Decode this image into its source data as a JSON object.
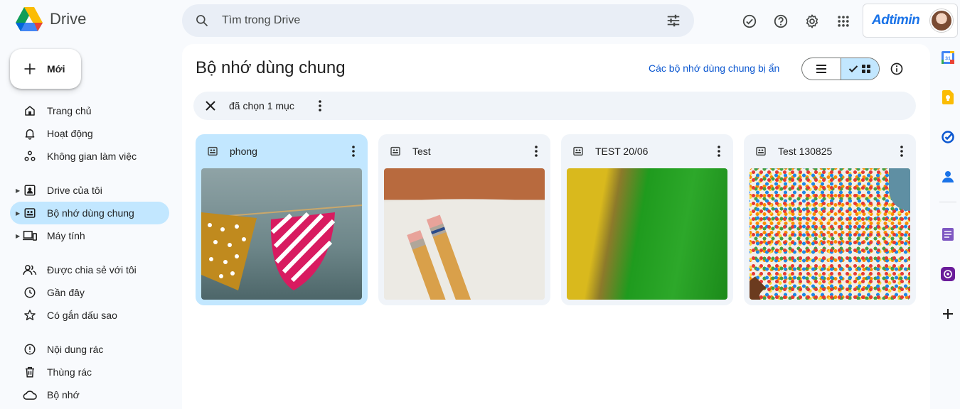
{
  "app": {
    "name": "Drive"
  },
  "search": {
    "placeholder": "Tìm trong Drive"
  },
  "account": {
    "brand": "Adtimin"
  },
  "new_button": {
    "label": "Mới"
  },
  "nav": {
    "items": [
      {
        "label": "Trang chủ",
        "icon": "home-icon"
      },
      {
        "label": "Hoạt động",
        "icon": "bell-icon"
      },
      {
        "label": "Không gian làm việc",
        "icon": "workspaces-icon"
      },
      {
        "label": "Drive của tôi",
        "icon": "my-drive-icon"
      },
      {
        "label": "Bộ nhớ dùng chung",
        "icon": "shared-drive-icon"
      },
      {
        "label": "Máy tính",
        "icon": "computer-icon"
      },
      {
        "label": "Được chia sẻ với tôi",
        "icon": "people-icon"
      },
      {
        "label": "Gần đây",
        "icon": "clock-icon"
      },
      {
        "label": "Có gắn dấu sao",
        "icon": "star-icon"
      },
      {
        "label": "Nội dung rác",
        "icon": "spam-icon"
      },
      {
        "label": "Thùng rác",
        "icon": "trash-icon"
      },
      {
        "label": "Bộ nhớ",
        "icon": "cloud-icon"
      }
    ]
  },
  "main": {
    "title": "Bộ nhớ dùng chung",
    "hidden_link": "Các bộ nhớ dùng chung bị ẩn",
    "selection": {
      "text": "đã chọn 1 mục"
    },
    "drives": [
      {
        "name": "phong",
        "selected": true
      },
      {
        "name": "Test",
        "selected": false
      },
      {
        "name": "TEST 20/06",
        "selected": false
      },
      {
        "name": "Test 130825",
        "selected": false
      }
    ]
  },
  "colors": {
    "accent": "#0b57d0",
    "selected": "#c2e7ff",
    "surface": "#f0f4f9"
  }
}
